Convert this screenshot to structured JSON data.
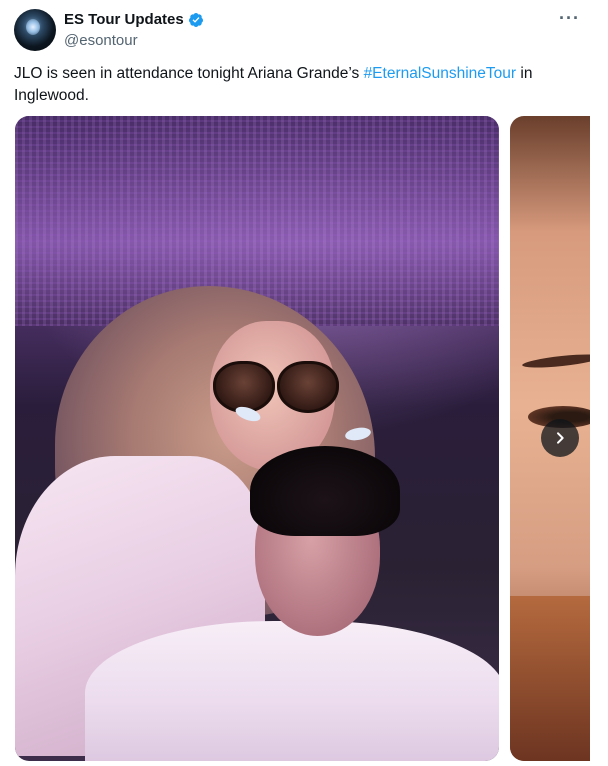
{
  "author": {
    "display_name": "ES Tour Updates",
    "handle": "@esontour",
    "verified_icon": "verified-badge-icon"
  },
  "menu_icon": "more-horizontal-icon",
  "more_glyph": "···",
  "tweet": {
    "text_before": "JLO is seen in attendance tonight Ariana Grande’s ",
    "hashtag": "#EternalSunshineTour",
    "text_after": " in Inglewood."
  },
  "media": {
    "count_visible": 2,
    "next_icon": "chevron-right-icon"
  },
  "colors": {
    "link": "#1d9bf0",
    "verified": "#1d9bf0",
    "secondary_text": "#536471"
  }
}
